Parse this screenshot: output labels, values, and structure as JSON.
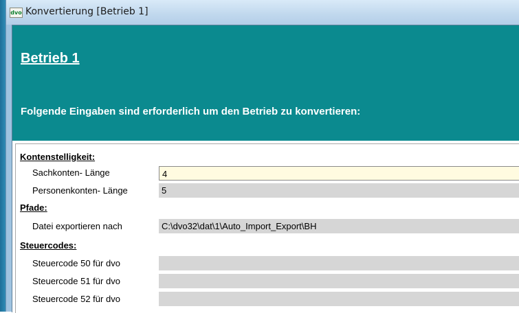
{
  "window": {
    "title": "Konvertierung [Betrieb 1]",
    "app_icon_text": "dvo"
  },
  "header": {
    "title": "Betrieb 1",
    "subtitle": "Folgende Eingaben sind erforderlich um den Betrieb zu konvertieren:"
  },
  "kontenstelligkeit": {
    "label": "Kontenstelligkeit:",
    "sachkonten_label": "Sachkonten- Länge",
    "sachkonten_value": "4",
    "personenkonten_label": "Personenkonten- Länge",
    "personenkonten_value": "5"
  },
  "pfade": {
    "label": "Pfade:",
    "export_label": "Datei exportieren nach",
    "export_value": "C:\\dvo32\\dat\\1\\Auto_Import_Export\\BH"
  },
  "steuercodes": {
    "label": "Steuercodes:",
    "items": [
      {
        "label": "Steuercode 50 für dvo",
        "value": ""
      },
      {
        "label": "Steuercode 51 für dvo",
        "value": ""
      },
      {
        "label": "Steuercode 52 für dvo",
        "value": ""
      }
    ]
  },
  "colors": {
    "header_bg": "#0b8a8f",
    "active_input_bg": "#fffbe0",
    "readonly_input_bg": "#d6d6d6"
  }
}
